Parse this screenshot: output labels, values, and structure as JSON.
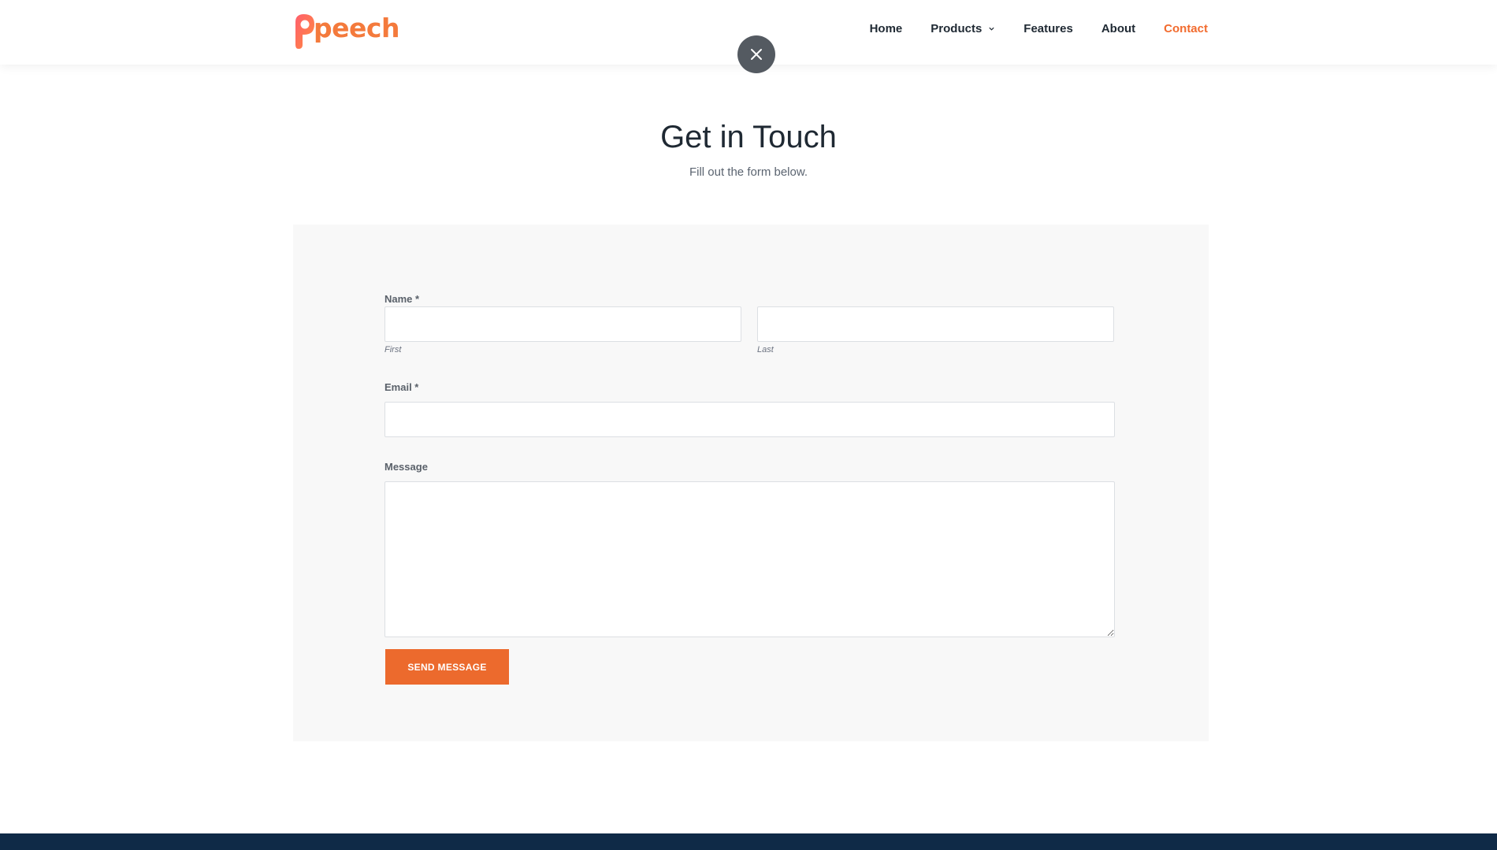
{
  "header": {
    "logo_text": "peech",
    "nav": [
      {
        "label": "Home"
      },
      {
        "label": "Products"
      },
      {
        "label": "Features"
      },
      {
        "label": "About"
      },
      {
        "label": "Contact"
      }
    ],
    "active_nav": "Contact"
  },
  "main": {
    "title": "Get in Touch",
    "subtitle": "Fill out the form below."
  },
  "form": {
    "name_label": "Name *",
    "first_sublabel": "First",
    "last_sublabel": "Last",
    "first_value": "",
    "last_value": "",
    "email_label": "Email *",
    "email_value": "",
    "message_label": "Message",
    "message_value": "",
    "submit_label": "SEND MESSAGE"
  },
  "colors": {
    "accent": "#f26b2e",
    "button": "#ec6a2d",
    "footer": "#0f2a47",
    "panel": "#f8f8f8",
    "close_button": "#545a61"
  },
  "icons": {
    "close": "close-icon",
    "products_dropdown": "chevron-down-icon"
  }
}
